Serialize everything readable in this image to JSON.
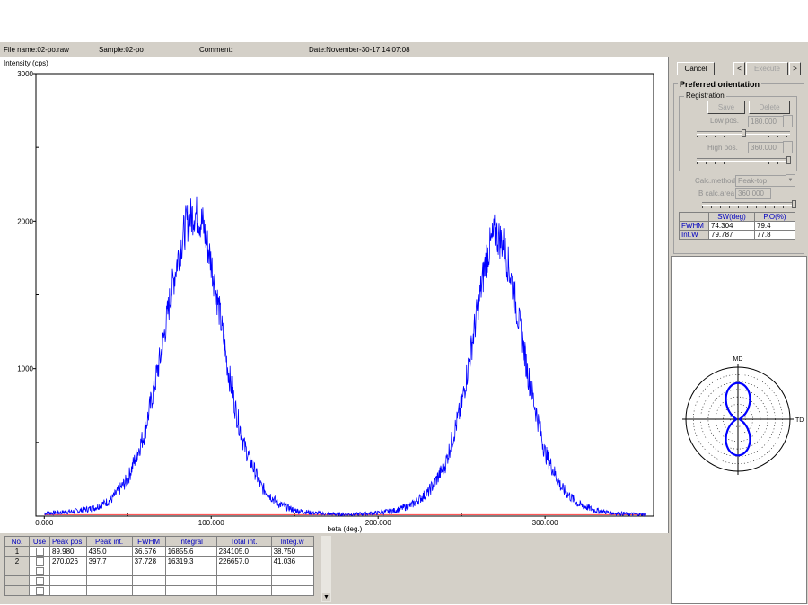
{
  "info_bar": {
    "file_name": "File name:02-po.raw",
    "sample": "Sample:02-po",
    "comment": "Comment:",
    "date": "Date:November-30-17 14:07:08"
  },
  "chart_data": {
    "type": "line",
    "ylabel": "Intensity (cps)",
    "xlabel": "beta (deg.)",
    "xlim": [
      -5,
      365
    ],
    "ylim": [
      0,
      3000
    ],
    "x_ticks": [
      "0.000",
      "100.000",
      "200.000",
      "300.000"
    ],
    "y_ticks": [
      "1000",
      "2000",
      "3000"
    ],
    "series": [
      {
        "x": [
          0,
          10,
          20,
          30,
          40,
          50,
          60,
          70,
          75,
          80,
          85,
          90,
          95,
          100,
          105,
          110,
          115,
          120,
          130,
          140,
          150,
          160,
          170,
          180,
          190,
          200,
          210,
          220,
          230,
          240,
          250,
          255,
          260,
          265,
          270,
          275,
          280,
          285,
          290,
          300,
          310,
          320,
          330,
          340,
          350,
          360
        ],
        "values": [
          20,
          25,
          35,
          55,
          110,
          250,
          560,
          1100,
          1450,
          1750,
          1980,
          2060,
          1980,
          1720,
          1380,
          1000,
          700,
          470,
          200,
          85,
          40,
          22,
          15,
          12,
          15,
          22,
          38,
          75,
          160,
          340,
          750,
          1080,
          1430,
          1760,
          1920,
          1850,
          1600,
          1280,
          950,
          430,
          190,
          80,
          40,
          22,
          15,
          12
        ]
      }
    ],
    "baseline": {
      "x": [
        0,
        360
      ],
      "values": [
        10,
        10
      ]
    }
  },
  "results_table": {
    "headers": [
      "No.",
      "Use",
      "Peak pos.",
      "Peak int.",
      "FWHM",
      "Integral",
      "Total int.",
      "Integ.w"
    ],
    "rows": [
      [
        "1",
        "",
        "89.980",
        "435.0",
        "36.576",
        "16855.6",
        "234105.0",
        "38.750"
      ],
      [
        "2",
        "",
        "270.026",
        "397.7",
        "37.728",
        "16319.3",
        "226657.0",
        "41.036"
      ]
    ]
  },
  "controls": {
    "cancel": "Cancel",
    "prev": "<",
    "execute": "Execute",
    "next": ">",
    "group_title": "Preferred orientation",
    "registration": "Registration",
    "save": "Save",
    "delete": "Delete",
    "low_pos_label": "Low pos.",
    "low_pos_value": "180.000",
    "high_pos_label": "High pos.",
    "high_pos_value": "360.000",
    "calc_method_label": "Calc.method",
    "calc_method_value": "Peak-top",
    "b_calc_area_label": "B calc.area",
    "b_calc_area_value": "360.000"
  },
  "sw_table": {
    "headers": [
      "",
      "SW(deg)",
      "P.O(%)"
    ],
    "rows": [
      [
        "FWHM",
        "74.304",
        "79.4"
      ],
      [
        "Int.W",
        "79.787",
        "77.8"
      ]
    ]
  },
  "polar": {
    "top_label": "MD",
    "right_label": "TD"
  },
  "colors": {
    "series": "#0000ff",
    "baseline": "#ff4040",
    "header_text": "#0000c0"
  }
}
